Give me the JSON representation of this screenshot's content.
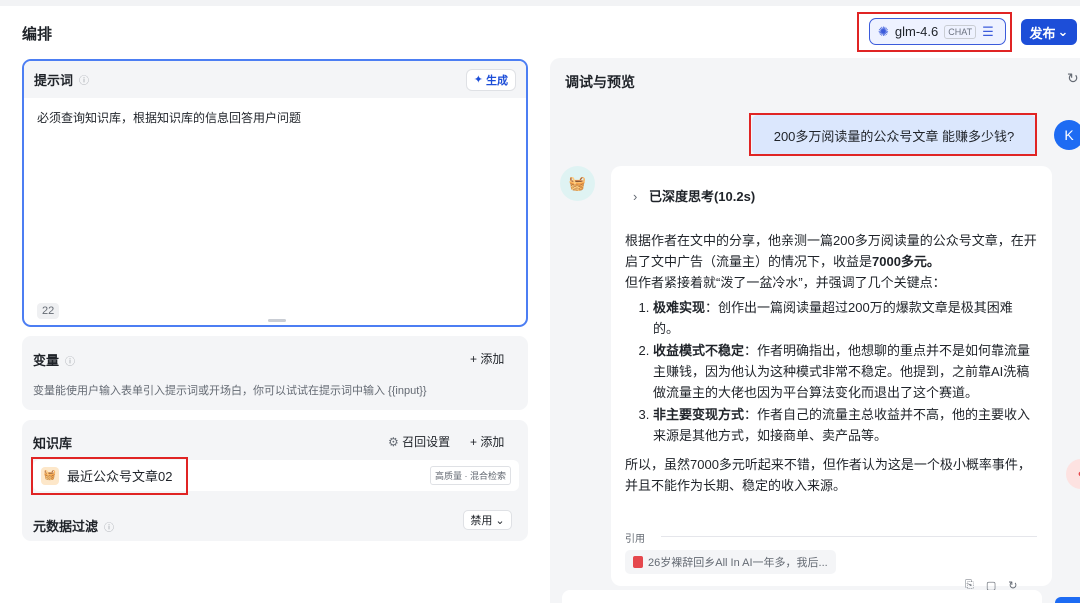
{
  "header": {
    "title": "编排",
    "model_name": "glm-4.6",
    "model_tag": "CHAT",
    "publish_label": "发布"
  },
  "prompt": {
    "title": "提示词",
    "generate_label": "生成",
    "text": "必须查询知识库，根据知识库的信息回答用户问题",
    "char_count": "22"
  },
  "variables": {
    "title": "变量",
    "add_label": "+ 添加",
    "description": "变量能使用户输入表单引入提示词或开场白，你可以试试在提示词中输入 {{input}}"
  },
  "knowledge": {
    "title": "知识库",
    "recall_label": "召回设置",
    "add_label": "+ 添加",
    "item_name": "最近公众号文章02",
    "item_tag": "高质量 · 混合检索"
  },
  "metadata_filter": {
    "title": "元数据过滤",
    "value": "禁用"
  },
  "preview": {
    "title": "调试与预览",
    "user_avatar": "K",
    "user_message": "200多万阅读量的公众号文章 能赚多少钱?",
    "thinking_label": "已深度思考(10.2s)",
    "answer_intro_1": "根据作者在文中的分享，他亲测一篇200多万阅读量的公众号文章，在开启了文中广告（流量主）的情况下，收益是",
    "answer_intro_bold": "7000多元。",
    "answer_intro_2": "但作者紧接着就“泼了一盆冷水”，并强调了几个关键点：",
    "points": [
      {
        "bold": "极难实现",
        "text": "：创作出一篇阅读量超过200万的爆款文章是极其困难的。"
      },
      {
        "bold": "收益模式不稳定",
        "text": "：作者明确指出，他想聊的重点并不是如何靠流量主赚钱，因为他认为这种模式非常不稳定。他提到，之前靠AI洗稿做流量主的大佬也因为平台算法变化而退出了这个赛道。"
      },
      {
        "bold": "非主要变现方式",
        "text": "：作者自己的流量主总收益并不高，他的主要收入来源是其他方式，如接商单、卖产品等。"
      }
    ],
    "conclusion": "所以，虽然7000多元听起来不错，但作者认为这是一个极小概率事件，并且不能作为长期、稳定的收入来源。",
    "citation_label": "引用",
    "citation_title": "26岁裸辞回乡All In AI一年多，我后..."
  },
  "colors": {
    "accent": "#1d4ed8",
    "highlight_border": "#e02424",
    "user_bubble": "#dbe7fd"
  }
}
